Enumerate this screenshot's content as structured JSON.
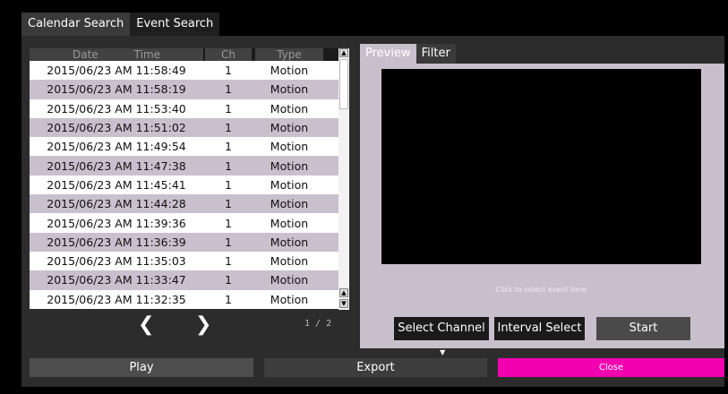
{
  "tabs": [
    "Calendar Search",
    "Event Search"
  ],
  "event_list": {
    "headers": [
      "Date",
      "Time",
      "Ch",
      "Type"
    ],
    "rows": [
      {
        "datetime": "2015/06/23 AM 11:58:49",
        "ch": "1",
        "type": "Motion"
      },
      {
        "datetime": "2015/06/23 AM 11:58:19",
        "ch": "1",
        "type": "Motion"
      },
      {
        "datetime": "2015/06/23 AM 11:53:40",
        "ch": "1",
        "type": "Motion"
      },
      {
        "datetime": "2015/06/23 AM 11:51:02",
        "ch": "1",
        "type": "Motion"
      },
      {
        "datetime": "2015/06/23 AM 11:49:54",
        "ch": "1",
        "type": "Motion"
      },
      {
        "datetime": "2015/06/23 AM 11:47:38",
        "ch": "1",
        "type": "Motion"
      },
      {
        "datetime": "2015/06/23 AM 11:45:41",
        "ch": "1",
        "type": "Motion"
      },
      {
        "datetime": "2015/06/23 AM 11:44:28",
        "ch": "1",
        "type": "Motion"
      },
      {
        "datetime": "2015/06/23 AM 11:39:36",
        "ch": "1",
        "type": "Motion"
      },
      {
        "datetime": "2015/06/23 AM 11:36:39",
        "ch": "1",
        "type": "Motion"
      },
      {
        "datetime": "2015/06/23 AM 11:35:03",
        "ch": "1",
        "type": "Motion"
      },
      {
        "datetime": "2015/06/23 AM 11:33:47",
        "ch": "1",
        "type": "Motion"
      },
      {
        "datetime": "2015/06/23 AM 11:32:35",
        "ch": "1",
        "type": "Motion"
      }
    ],
    "prev_glyph": "❮",
    "next_glyph": "❯",
    "page_info": "1 / 2"
  },
  "preview": {
    "tabs": [
      "Preview",
      "Filter"
    ],
    "hint": "Click to select event time.",
    "select_channel": "Select Channel",
    "interval_select": "Interval Select",
    "start": "Start"
  },
  "bottom": {
    "play": "Play",
    "export": "Export",
    "close": "Close"
  },
  "colors": {
    "close_accent": "#f200b0",
    "row_alt": "#c9c0cd",
    "preview_bg": "#c8bfcc"
  }
}
